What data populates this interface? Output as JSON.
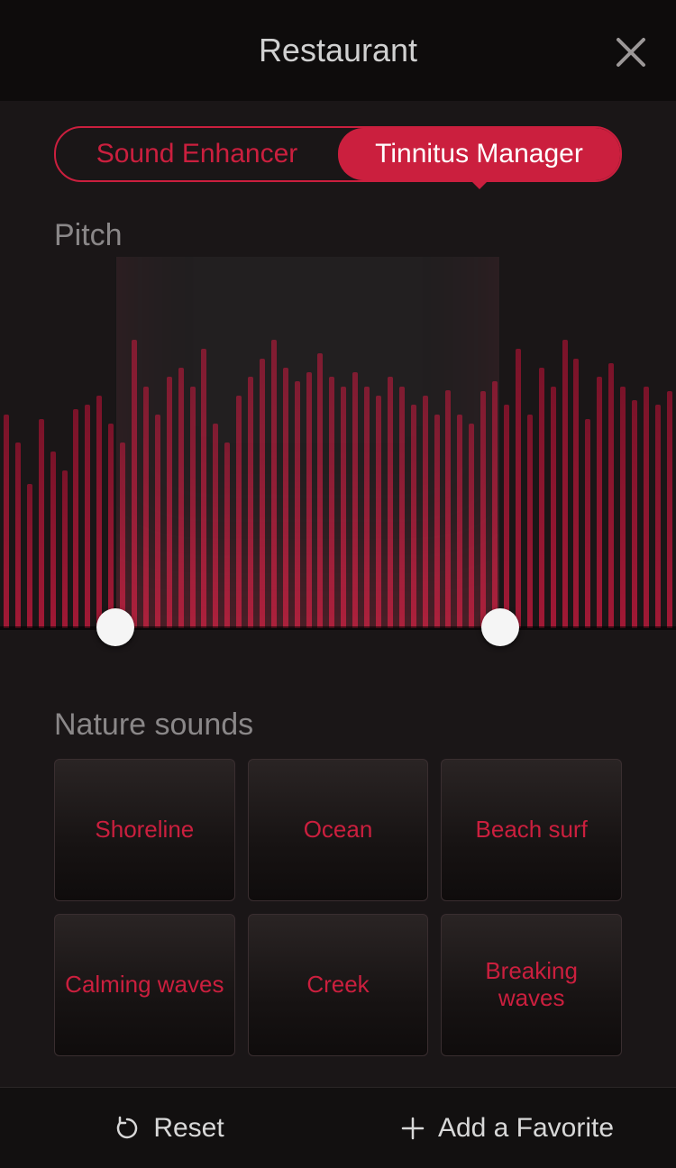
{
  "header": {
    "title": "Restaurant"
  },
  "tabs": {
    "sound_enhancer": "Sound Enhancer",
    "tinnitus_manager": "Tinnitus Manager"
  },
  "pitch": {
    "label": "Pitch",
    "range_low_pct": 17,
    "range_high_pct": 74,
    "bars": [
      230,
      200,
      155,
      225,
      190,
      170,
      235,
      240,
      250,
      220,
      200,
      310,
      260,
      230,
      270,
      280,
      260,
      300,
      220,
      200,
      250,
      270,
      290,
      310,
      280,
      265,
      275,
      295,
      270,
      260,
      275,
      260,
      250,
      270,
      260,
      240,
      250,
      230,
      256,
      230,
      220,
      255,
      265,
      240,
      300,
      230,
      280,
      260,
      310,
      290,
      225,
      270,
      285,
      260,
      245,
      260,
      240,
      255
    ]
  },
  "nature": {
    "label": "Nature sounds",
    "items": [
      "Shoreline",
      "Ocean",
      "Beach surf",
      "Calming waves",
      "Creek",
      "Breaking waves"
    ]
  },
  "footer": {
    "reset": "Reset",
    "add_favorite": "Add a Favorite"
  }
}
